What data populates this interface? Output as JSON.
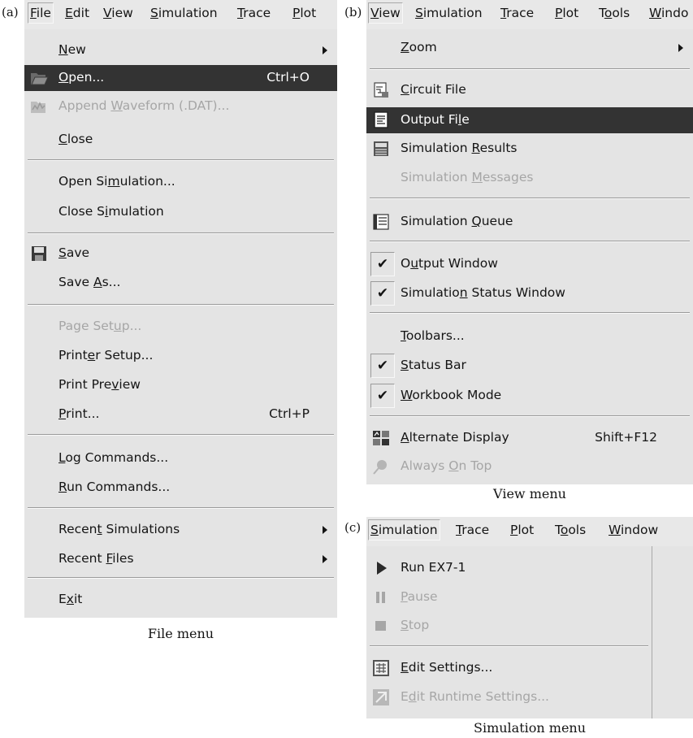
{
  "panel_labels": {
    "a": "(a)",
    "b": "(b)",
    "c": "(c)"
  },
  "file_panel": {
    "menubar": [
      "File",
      "Edit",
      "View",
      "Simulation",
      "Trace",
      "Plot"
    ],
    "items": [
      {
        "label": "New",
        "mnemonic": "N",
        "shortcut": "",
        "submenu": true,
        "disabled": false,
        "highlighted": false,
        "icon": ""
      },
      {
        "label": "Open...",
        "mnemonic": "O",
        "shortcut": "Ctrl+O",
        "submenu": false,
        "disabled": false,
        "highlighted": true,
        "icon": "open-folder-icon"
      },
      {
        "label": "Append Waveform (.DAT)...",
        "mnemonic": "W",
        "shortcut": "",
        "submenu": false,
        "disabled": true,
        "highlighted": false,
        "icon": "append-waveform-icon"
      },
      {
        "label": "Close",
        "mnemonic": "C",
        "shortcut": "",
        "submenu": false,
        "disabled": false,
        "highlighted": false,
        "icon": ""
      },
      {
        "label": "Open Simulation...",
        "mnemonic": "m",
        "shortcut": "",
        "submenu": false,
        "disabled": false,
        "highlighted": false,
        "icon": ""
      },
      {
        "label": "Close Simulation",
        "mnemonic": "i",
        "shortcut": "",
        "submenu": false,
        "disabled": false,
        "highlighted": false,
        "icon": ""
      },
      {
        "label": "Save",
        "mnemonic": "S",
        "shortcut": "",
        "submenu": false,
        "disabled": false,
        "highlighted": false,
        "icon": "floppy-disk-icon"
      },
      {
        "label": "Save As...",
        "mnemonic": "A",
        "shortcut": "",
        "submenu": false,
        "disabled": false,
        "highlighted": false,
        "icon": ""
      },
      {
        "label": "Page Setup...",
        "mnemonic": "u",
        "shortcut": "",
        "submenu": false,
        "disabled": true,
        "highlighted": false,
        "icon": ""
      },
      {
        "label": "Printer Setup...",
        "mnemonic": "e",
        "shortcut": "",
        "submenu": false,
        "disabled": false,
        "highlighted": false,
        "icon": ""
      },
      {
        "label": "Print Preview",
        "mnemonic": "v",
        "shortcut": "",
        "submenu": false,
        "disabled": false,
        "highlighted": false,
        "icon": ""
      },
      {
        "label": "Print...",
        "mnemonic": "P",
        "shortcut": "Ctrl+P",
        "submenu": false,
        "disabled": false,
        "highlighted": false,
        "icon": ""
      },
      {
        "label": "Log Commands...",
        "mnemonic": "L",
        "shortcut": "",
        "submenu": false,
        "disabled": false,
        "highlighted": false,
        "icon": ""
      },
      {
        "label": "Run Commands...",
        "mnemonic": "R",
        "shortcut": "",
        "submenu": false,
        "disabled": false,
        "highlighted": false,
        "icon": ""
      },
      {
        "label": "Recent Simulations",
        "mnemonic": "t",
        "shortcut": "",
        "submenu": true,
        "disabled": false,
        "highlighted": false,
        "icon": ""
      },
      {
        "label": "Recent Files",
        "mnemonic": "F",
        "shortcut": "",
        "submenu": true,
        "disabled": false,
        "highlighted": false,
        "icon": ""
      },
      {
        "label": "Exit",
        "mnemonic": "x",
        "shortcut": "",
        "submenu": false,
        "disabled": false,
        "highlighted": false,
        "icon": ""
      }
    ],
    "caption": "File menu"
  },
  "view_panel": {
    "menubar": [
      "View",
      "Simulation",
      "Trace",
      "Plot",
      "Tools",
      "Windo"
    ],
    "items": [
      {
        "label": "Zoom",
        "mnemonic": "Z",
        "shortcut": "",
        "submenu": true,
        "disabled": false,
        "highlighted": false,
        "checked": false,
        "icon": ""
      },
      {
        "label": "Circuit File",
        "mnemonic": "C",
        "shortcut": "",
        "submenu": false,
        "disabled": false,
        "highlighted": false,
        "checked": false,
        "icon": "circuit-file-icon"
      },
      {
        "label": "Output File",
        "mnemonic": "l",
        "shortcut": "",
        "submenu": false,
        "disabled": false,
        "highlighted": true,
        "checked": false,
        "icon": "output-file-icon"
      },
      {
        "label": "Simulation Results",
        "mnemonic": "R",
        "shortcut": "",
        "submenu": false,
        "disabled": false,
        "highlighted": false,
        "checked": false,
        "icon": "simulation-results-icon"
      },
      {
        "label": "Simulation Messages",
        "mnemonic": "M",
        "shortcut": "",
        "submenu": false,
        "disabled": true,
        "highlighted": false,
        "checked": false,
        "icon": ""
      },
      {
        "label": "Simulation Queue",
        "mnemonic": "Q",
        "shortcut": "",
        "submenu": false,
        "disabled": false,
        "highlighted": false,
        "checked": false,
        "icon": "simulation-queue-icon"
      },
      {
        "label": "Output Window",
        "mnemonic": "u",
        "shortcut": "",
        "submenu": false,
        "disabled": false,
        "highlighted": false,
        "checked": true,
        "icon": ""
      },
      {
        "label": "Simulation Status Window",
        "mnemonic": "n",
        "shortcut": "",
        "submenu": false,
        "disabled": false,
        "highlighted": false,
        "checked": true,
        "icon": ""
      },
      {
        "label": "Toolbars...",
        "mnemonic": "T",
        "shortcut": "",
        "submenu": false,
        "disabled": false,
        "highlighted": false,
        "checked": false,
        "icon": ""
      },
      {
        "label": "Status Bar",
        "mnemonic": "S",
        "shortcut": "",
        "submenu": false,
        "disabled": false,
        "highlighted": false,
        "checked": true,
        "icon": ""
      },
      {
        "label": "Workbook Mode",
        "mnemonic": "W",
        "shortcut": "",
        "submenu": false,
        "disabled": false,
        "highlighted": false,
        "checked": true,
        "icon": ""
      },
      {
        "label": "Alternate Display",
        "mnemonic": "A",
        "shortcut": "Shift+F12",
        "submenu": false,
        "disabled": false,
        "highlighted": false,
        "checked": false,
        "icon": "alternate-display-icon"
      },
      {
        "label": "Always On Top",
        "mnemonic": "O",
        "shortcut": "",
        "submenu": false,
        "disabled": true,
        "highlighted": false,
        "checked": false,
        "icon": "pin-icon"
      }
    ],
    "caption": "View menu"
  },
  "sim_panel": {
    "menubar": [
      "Simulation",
      "Trace",
      "Plot",
      "Tools",
      "Window"
    ],
    "items": [
      {
        "label": "Run  EX7-1",
        "mnemonic": "",
        "shortcut": "",
        "submenu": false,
        "disabled": false,
        "highlighted": false,
        "icon": "run-icon"
      },
      {
        "label": "Pause",
        "mnemonic": "P",
        "shortcut": "",
        "submenu": false,
        "disabled": true,
        "highlighted": false,
        "icon": "pause-icon"
      },
      {
        "label": "Stop",
        "mnemonic": "S",
        "shortcut": "",
        "submenu": false,
        "disabled": true,
        "highlighted": false,
        "icon": "stop-icon"
      },
      {
        "label": "Edit Settings...",
        "mnemonic": "E",
        "shortcut": "",
        "submenu": false,
        "disabled": false,
        "highlighted": false,
        "icon": "edit-settings-icon"
      },
      {
        "label": "Edit Runtime Settings...",
        "mnemonic": "d",
        "shortcut": "",
        "submenu": false,
        "disabled": true,
        "highlighted": false,
        "icon": "edit-runtime-settings-icon"
      }
    ],
    "caption": "Simulation menu"
  },
  "menubar_mnemonics": {
    "file": [
      "F",
      "E",
      "V",
      "S",
      "T",
      "P"
    ],
    "view": [
      "V",
      "S",
      "T",
      "P",
      "o",
      "W"
    ],
    "sim": [
      "S",
      "T",
      "P",
      "o",
      "W"
    ]
  }
}
